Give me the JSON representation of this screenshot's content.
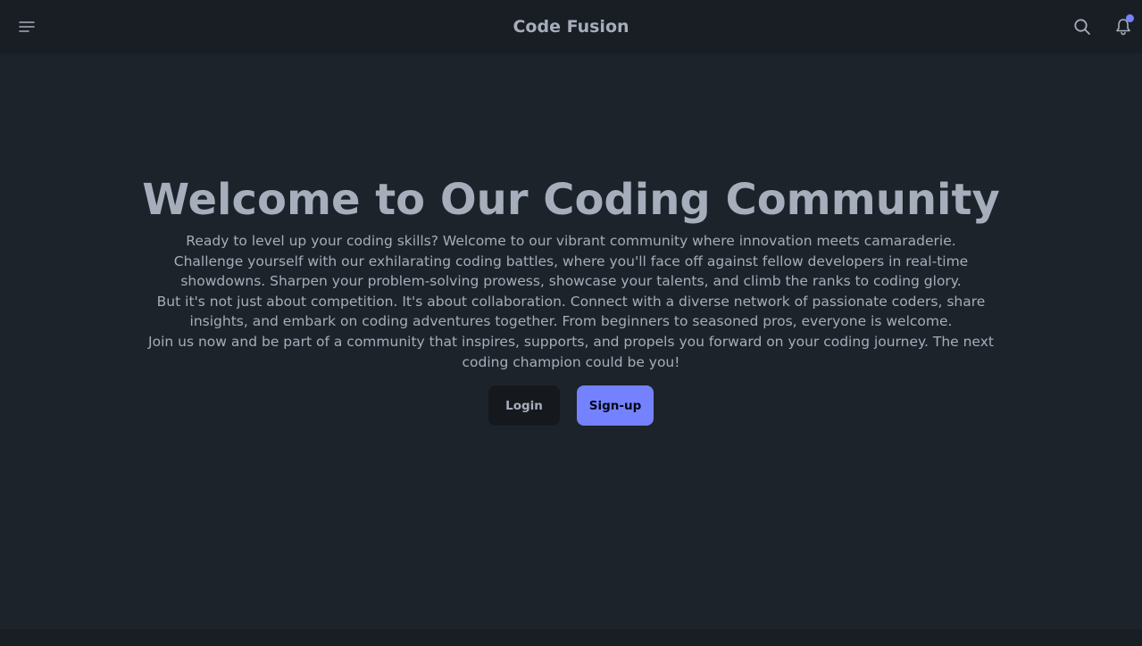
{
  "navbar": {
    "brand": "Code Fusion",
    "menu_icon": "menu-icon",
    "search_icon": "search-icon",
    "bell_icon": "bell-icon",
    "has_notification": true
  },
  "hero": {
    "title": "Welcome to Our Coding Community",
    "paragraphs": [
      "Ready to level up your coding skills? Welcome to our vibrant community where innovation meets camaraderie.",
      "Challenge yourself with our exhilarating coding battles, where you'll face off against fellow developers in real-time showdowns. Sharpen your problem-solving prowess, showcase your talents, and climb the ranks to coding glory.",
      "But it's not just about competition. It's about collaboration. Connect with a diverse network of passionate coders, share insights, and embark on coding adventures together. From beginners to seasoned pros, everyone is welcome.",
      "Join us now and be part of a community that inspires, supports, and propels you forward on your coding journey. The next coding champion could be you!"
    ],
    "login_label": "Login",
    "signup_label": "Sign-up"
  },
  "colors": {
    "background": "#1d232a",
    "navbar": "#191e24",
    "text": "#a6adbb",
    "primary": "#7582ff",
    "dark_button": "#15191e"
  }
}
